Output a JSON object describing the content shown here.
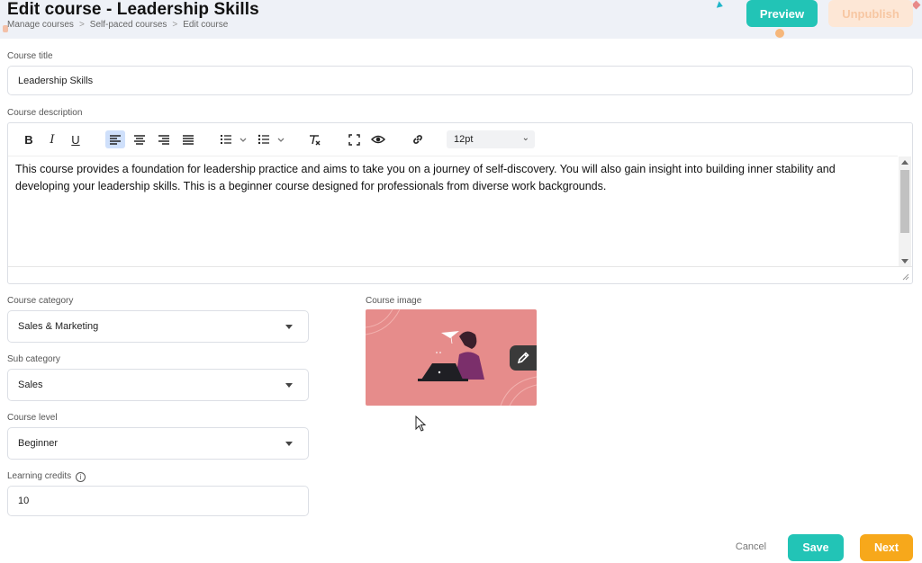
{
  "header": {
    "title": "Edit course - Leadership Skills",
    "breadcrumb": [
      "Manage courses",
      "Self-paced courses",
      "Edit course"
    ],
    "breadcrumb_separator": ">",
    "preview_label": "Preview",
    "unpublish_label": "Unpublish"
  },
  "form": {
    "course_title": {
      "label": "Course title",
      "value": "Leadership Skills"
    },
    "course_description": {
      "label": "Course description",
      "value": "This course provides a foundation for leadership practice and aims to take you on a journey of self-discovery. You will also gain insight into building inner stability and developing your leadership skills. This is a beginner course designed for professionals from diverse work backgrounds."
    },
    "editor_toolbar": {
      "bold": "B",
      "italic": "I",
      "underline": "U",
      "font_size": "12pt"
    },
    "course_category": {
      "label": "Course category",
      "value": "Sales & Marketing"
    },
    "sub_category": {
      "label": "Sub category",
      "value": "Sales"
    },
    "course_level": {
      "label": "Course level",
      "value": "Beginner"
    },
    "learning_credits": {
      "label": "Learning credits",
      "value": "10",
      "info_glyph": "i"
    },
    "course_image": {
      "label": "Course image"
    }
  },
  "footer": {
    "cancel_label": "Cancel",
    "save_label": "Save",
    "next_label": "Next"
  },
  "colors": {
    "primary": "#22c4b6",
    "accent": "#f7a81b",
    "header_bg": "#eef1f7",
    "image_bg": "#e68c8b"
  }
}
